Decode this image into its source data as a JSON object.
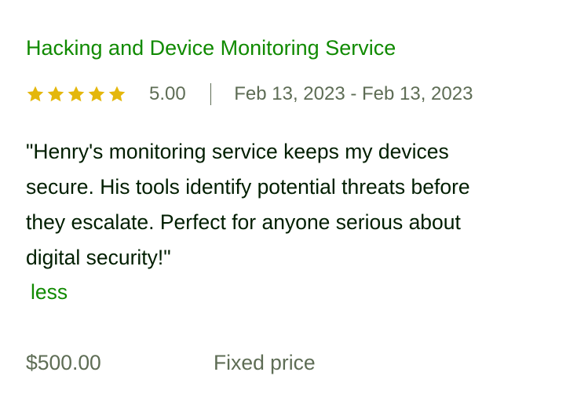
{
  "job": {
    "title": "Hacking and Device Monitoring Service",
    "rating": {
      "value": "5.00",
      "stars": 5,
      "star_color": "#e4b70c"
    },
    "date_range": "Feb 13, 2023 - Feb 13, 2023",
    "review_lines": [
      "\"Henry's monitoring service keeps my devices",
      "secure. His tools identify potential threats before",
      "they escalate. Perfect for anyone serious about",
      "digital security!\""
    ],
    "less_label": "less",
    "price": "$500.00",
    "price_type": "Fixed price"
  },
  "colors": {
    "accent_green": "#108a00",
    "muted_text": "#5e6d55",
    "body_text": "#001e00"
  }
}
